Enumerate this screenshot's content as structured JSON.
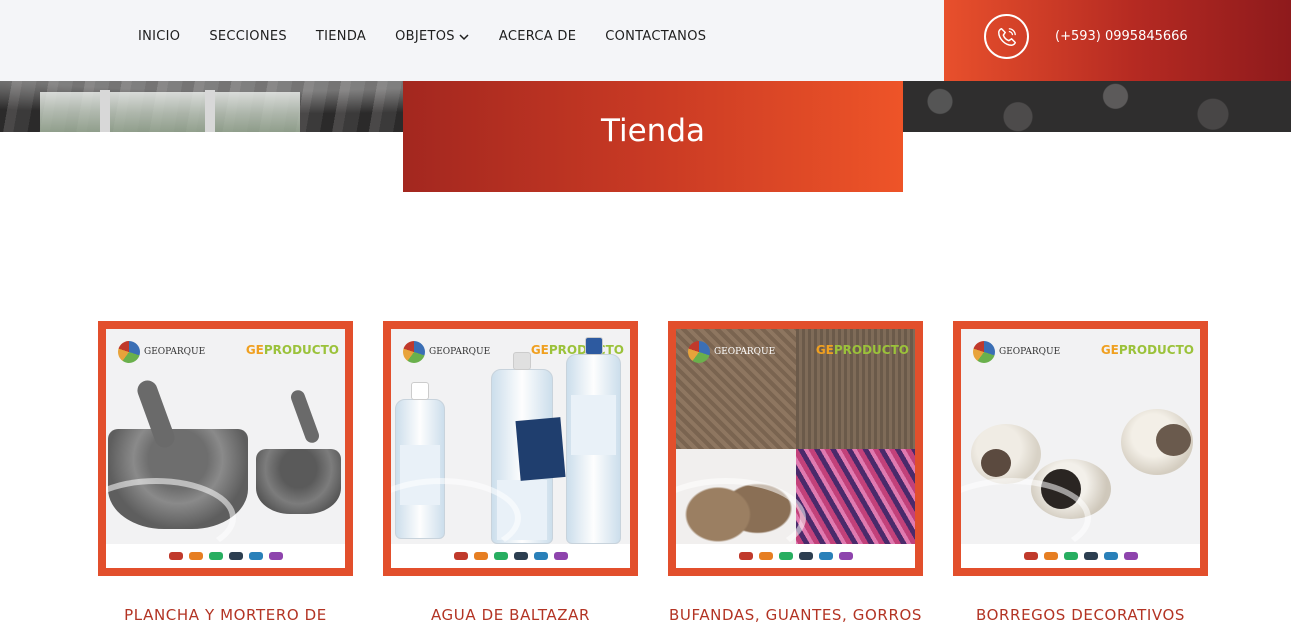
{
  "nav": {
    "items": [
      "INICIO",
      "SECCIONES",
      "TIENDA",
      "OBJETOS",
      "ACERCA DE",
      "CONTACTANOS"
    ]
  },
  "contact": {
    "phone": "(+593) 0995845666",
    "icon": "phone-icon"
  },
  "page_title": "Tienda",
  "products": [
    {
      "title": "PLANCHA Y MORTERO DE",
      "brand_left": "GEOPARQUE",
      "brand_right_a": "GE",
      "brand_right_b": "PRODUCTO"
    },
    {
      "title": "AGUA DE BALTAZAR",
      "brand_left": "GEOPARQUE",
      "brand_right_a": "GE",
      "brand_right_b": "PRODUCTO"
    },
    {
      "title": "BUFANDAS, GUANTES, GORROS",
      "brand_left": "GEOPARQUE",
      "brand_right_a": "GE",
      "brand_right_b": "PRODUCTO"
    },
    {
      "title": "BORREGOS DECORATIVOS",
      "brand_left": "GEOPARQUE",
      "brand_right_a": "GE",
      "brand_right_b": "PRODUCTO"
    }
  ],
  "colors": {
    "accent": "#e24f2c",
    "title_red": "#b33424",
    "nav_bg": "#f4f5f8"
  }
}
